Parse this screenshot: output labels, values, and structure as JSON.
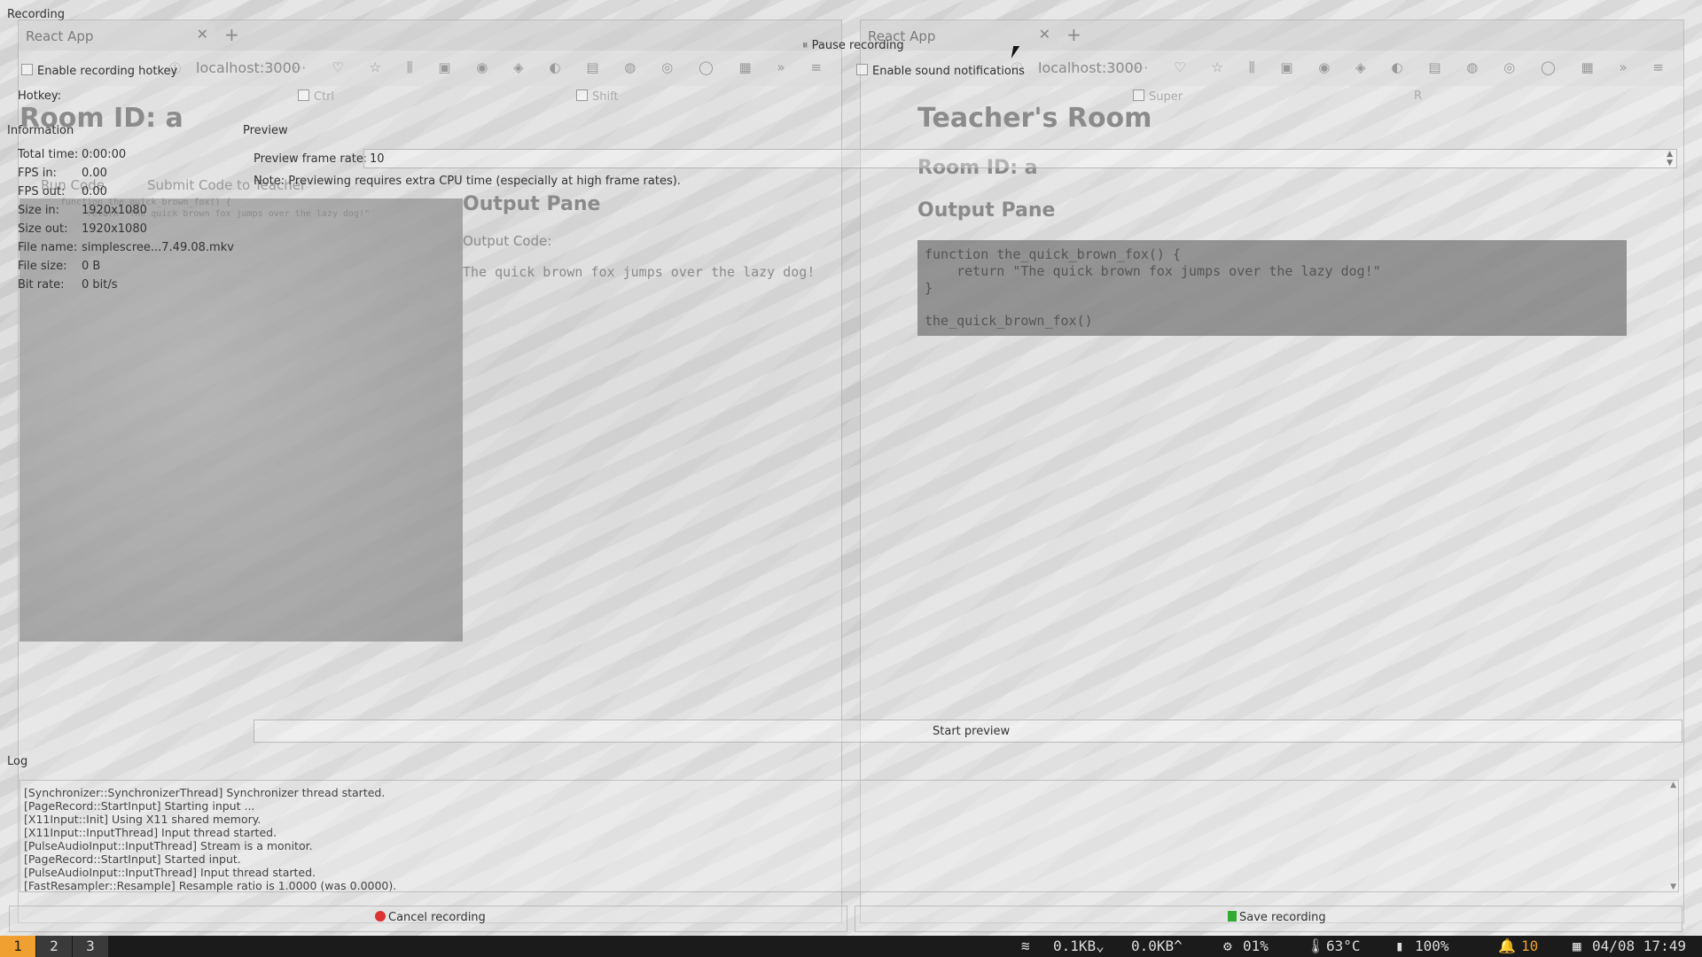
{
  "recorder": {
    "window_title": "Recording",
    "pause_label": "Pause recording",
    "hotkey_checkbox": "Enable recording hotkey",
    "sound_checkbox": "Enable sound notifications",
    "hotkey_label": "Hotkey:",
    "modifiers": [
      "Ctrl",
      "Shift",
      "Super",
      "R"
    ],
    "information_title": "Information",
    "info": [
      {
        "label": "Total time:",
        "value": "0:00:00"
      },
      {
        "label": "FPS in:",
        "value": "0.00"
      },
      {
        "label": "FPS out:",
        "value": "0.00"
      },
      {
        "label": "Size in:",
        "value": "1920x1080"
      },
      {
        "label": "Size out:",
        "value": "1920x1080"
      },
      {
        "label": "File name:",
        "value": "simplescree...7.49.08.mkv"
      },
      {
        "label": "File size:",
        "value": "0 B"
      },
      {
        "label": "Bit rate:",
        "value": "0 bit/s"
      }
    ],
    "preview_title": "Preview",
    "preview_rate_label": "Preview frame rate:",
    "preview_rate_value": "10",
    "preview_note": "Note: Previewing requires extra CPU time (especially at high frame rates).",
    "start_preview": "Start preview",
    "log_title": "Log",
    "log_lines": [
      "[Synchronizer::SynchronizerThread] Synchronizer thread started.",
      "[PageRecord::StartInput] Starting input ...",
      "[X11Input::Init] Using X11 shared memory.",
      "[X11Input::InputThread] Input thread started.",
      "[PulseAudioInput::InputThread] Stream is a monitor.",
      "[PageRecord::StartInput] Started input.",
      "[PulseAudioInput::InputThread] Input thread started.",
      "[FastResampler::Resample] Resample ratio is 1.0000 (was 0.0000)."
    ],
    "cancel_label": "Cancel recording",
    "save_label": "Save recording"
  },
  "left_browser": {
    "tab_title": "React App",
    "url": "localhost:3000",
    "room_title": "Room ID: a",
    "run_code": "Run Code",
    "submit_code": "Submit Code to Teacher",
    "code_line1": "function the_quick_brown_fox() {",
    "code_line2": "return \"The quick brown fox jumps over the lazy dog!\"",
    "output_heading": "Output Pane",
    "output_code_label": "Output Code:",
    "output_text": "The quick brown fox jumps over the lazy dog!"
  },
  "right_browser": {
    "tab_title": "React App",
    "url": "localhost:3000",
    "teacher_title": "Teacher's Room",
    "room_id": "Room ID: a",
    "output_heading": "Output Pane",
    "code": [
      "function the_quick_brown_fox() {",
      "    return \"The quick brown fox jumps over the lazy dog!\"",
      "}",
      "",
      "the_quick_brown_fox()"
    ]
  },
  "statusbar": {
    "workspaces": [
      "1",
      "2",
      "3"
    ],
    "active_workspace": "1",
    "net_down": "0.1KB",
    "net_up": "0.0KB",
    "cpu": "01%",
    "temp": "63°C",
    "battery": "100%",
    "notifications": "10",
    "datetime": "04/08 17:49",
    "colors": {
      "active_ws": "#f0a030",
      "notif": "#f0a030"
    }
  }
}
